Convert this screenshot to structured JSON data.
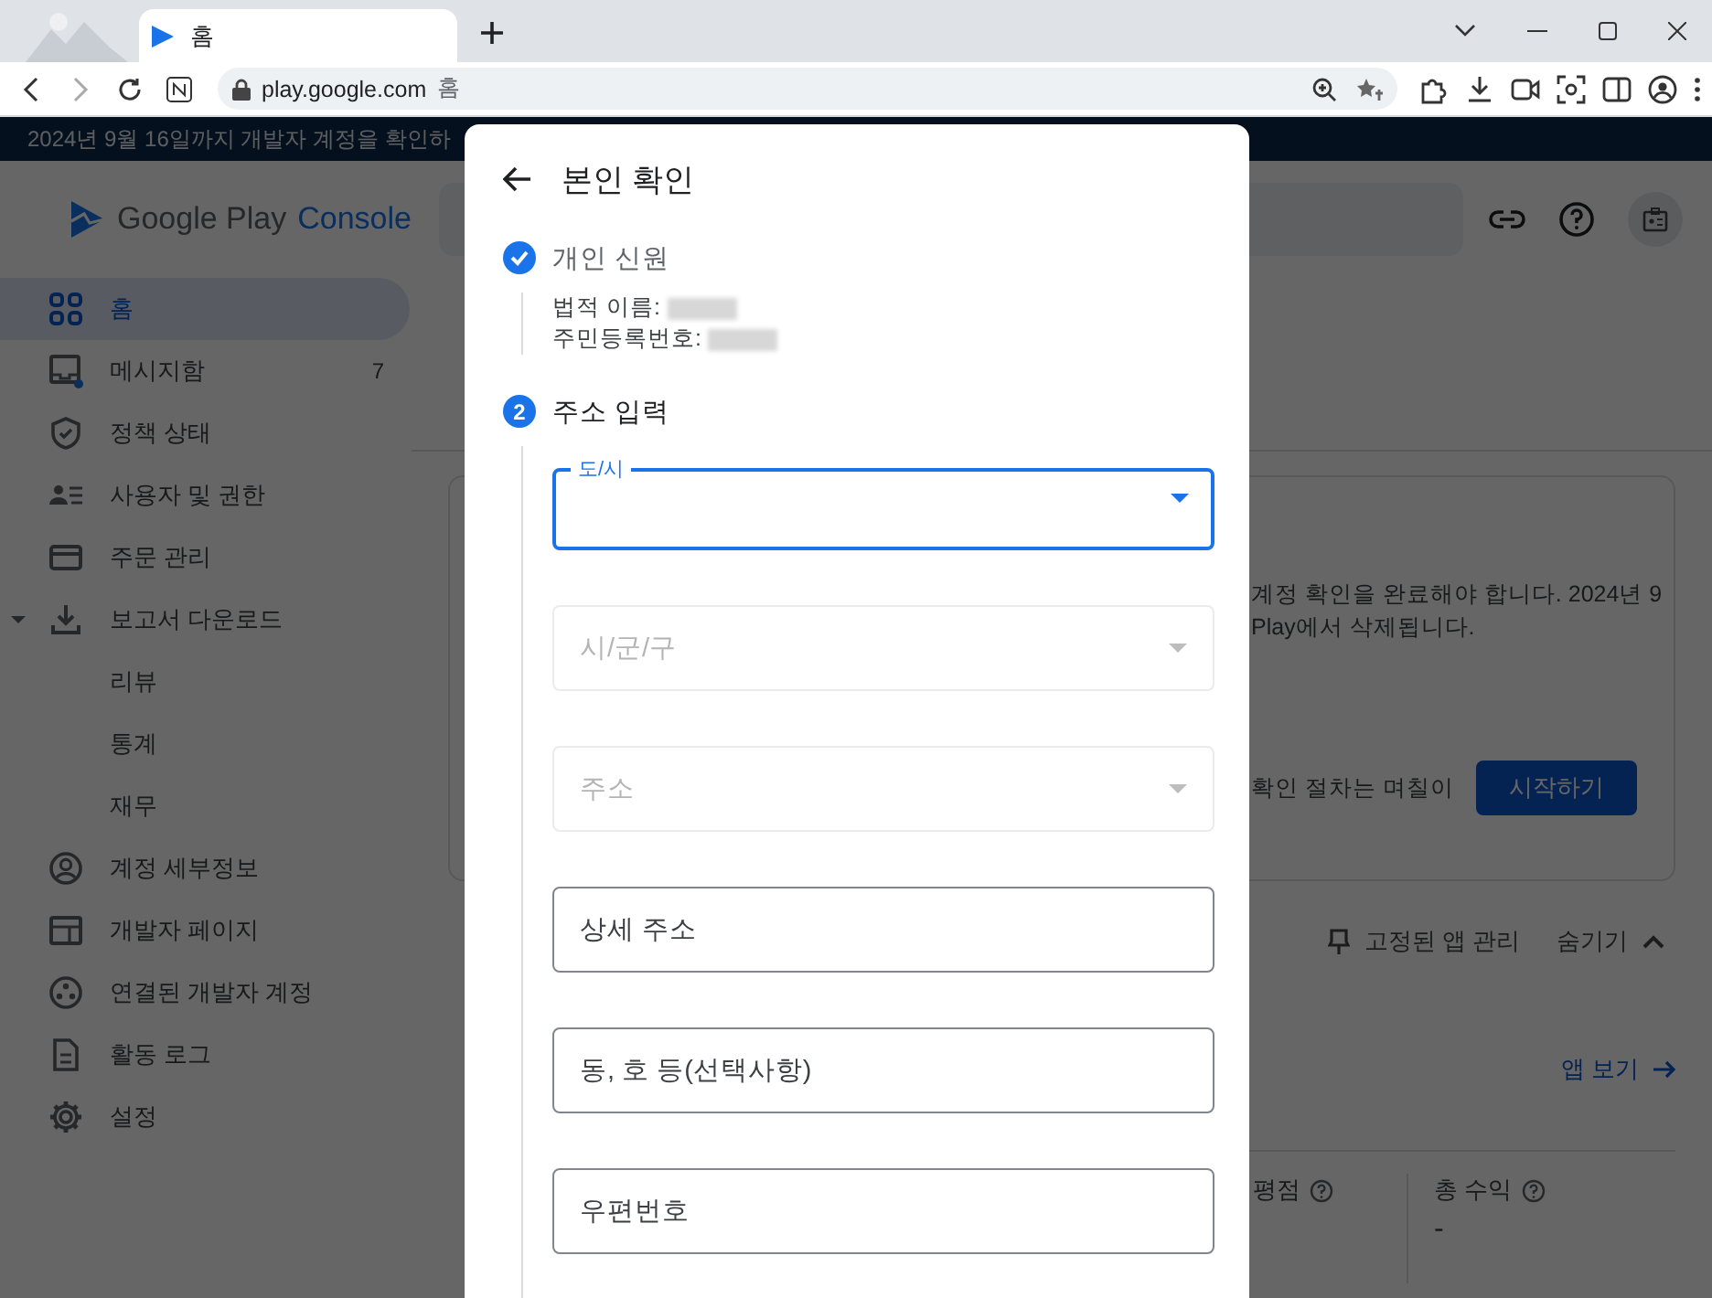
{
  "browser": {
    "tab_title": "홈",
    "url_host": "play.google.com",
    "url_page": "홈"
  },
  "banner": {
    "text": "2024년 9월 16일까지 개발자 계정을 확인하"
  },
  "header": {
    "brand": "Google Play",
    "product": "Console"
  },
  "sidebar": {
    "items": [
      {
        "label": "홈",
        "selected": true
      },
      {
        "label": "메시지함",
        "selected": false,
        "badge": "7"
      },
      {
        "label": "정책 상태",
        "selected": false
      },
      {
        "label": "사용자 및 권한",
        "selected": false
      },
      {
        "label": "주문 관리",
        "selected": false
      },
      {
        "label": "보고서 다운로드",
        "selected": false,
        "expanded": true,
        "children": [
          {
            "label": "리뷰",
            "selected": false
          },
          {
            "label": "통계",
            "selected": false
          },
          {
            "label": "재무",
            "selected": false
          }
        ]
      },
      {
        "label": "계정 세부정보",
        "selected": false
      },
      {
        "label": "개발자 페이지",
        "selected": false
      },
      {
        "label": "연결된 개발자 계정",
        "selected": false
      },
      {
        "label": "활동 로그",
        "selected": false
      },
      {
        "label": "설정",
        "selected": false
      }
    ]
  },
  "main": {
    "card": {
      "lines": [
        "계정 확인을 완료해야 합니다. 2024년 9",
        "Play에서 삭제됩니다."
      ],
      "note": "확인 절차는 며칠이",
      "button": "시작하기"
    },
    "pinned_bar": {
      "manage": "고정된 앱 관리",
      "toggle": "숨기기",
      "expanded": true
    },
    "view_apps": "앱 보기",
    "stats": [
      {
        "label": "평점"
      },
      {
        "label": "총 수익",
        "value": "-"
      }
    ]
  },
  "dialog": {
    "title": "본인 확인",
    "steps": [
      {
        "kind": "done",
        "label": "개인 신원",
        "details": [
          {
            "label": "법적 이름:",
            "redacted": true
          },
          {
            "label": "주민등록번호:",
            "redacted": true
          }
        ]
      },
      {
        "kind": "current",
        "number": "2",
        "label": "주소 입력",
        "fields": [
          {
            "kind": "select",
            "label": "도/시",
            "focused": true,
            "disabled": false
          },
          {
            "kind": "select",
            "label": "시/군/구",
            "focused": false,
            "disabled": true
          },
          {
            "kind": "select",
            "label": "주소",
            "focused": false,
            "disabled": true
          },
          {
            "kind": "text",
            "placeholder": "상세 주소",
            "focused": false,
            "disabled": false
          },
          {
            "kind": "text",
            "placeholder": "동, 호 등(선택사항)",
            "focused": false,
            "disabled": false
          },
          {
            "kind": "text",
            "placeholder": "우편번호",
            "focused": false,
            "disabled": false
          }
        ]
      }
    ]
  }
}
